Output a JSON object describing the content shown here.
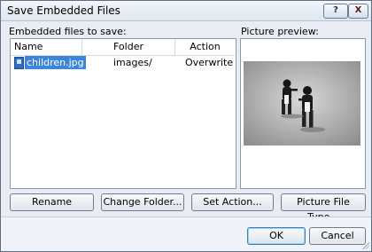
{
  "window": {
    "title": "Save Embedded Files",
    "help_label": "?",
    "close_label": "X"
  },
  "files_section": {
    "label": "Embedded files to save:",
    "columns": [
      "Name",
      "Folder",
      "Action"
    ],
    "rows": [
      {
        "name": "children.jpg",
        "folder": "images/",
        "action": "Overwrite",
        "icon": "image-file-icon",
        "selected": true
      }
    ]
  },
  "preview_section": {
    "label": "Picture preview:"
  },
  "actions": {
    "rename": "Rename",
    "change_folder": "Change Folder...",
    "set_action": "Set Action...",
    "picture_file_type": "Picture File Type..."
  },
  "footer": {
    "ok": "OK",
    "cancel": "Cancel"
  },
  "colors": {
    "selection": "#3c85d8",
    "dialog_background": "#e9edf3"
  }
}
